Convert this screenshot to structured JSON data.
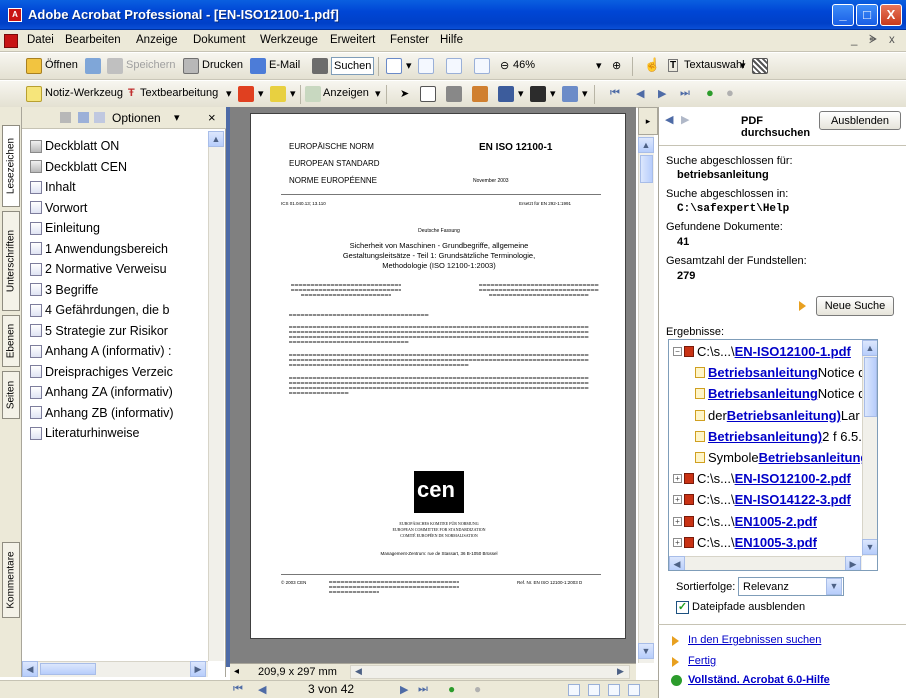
{
  "window": {
    "title": "Adobe Acrobat Professional - [EN-ISO12100-1.pdf]",
    "icon_label": "A",
    "buttons": {
      "minimize": "_",
      "maximize": "□",
      "close": "X"
    }
  },
  "menubar": {
    "items": [
      "Datei",
      "Bearbeiten",
      "Anzeige",
      "Dokument",
      "Werkzeuge",
      "Erweitert",
      "Fenster",
      "Hilfe"
    ],
    "doc_controls": [
      "_",
      "ᗙ",
      "x"
    ]
  },
  "toolbar1": {
    "open": "Öffnen",
    "save": "Speichern",
    "print": "Drucken",
    "email": "E-Mail",
    "search": "Suchen",
    "zoom": "46%",
    "text_select": "Textauswahl"
  },
  "toolbar2": {
    "note_tool": "Notiz-Werkzeug",
    "text_edit": "Textbearbeitung",
    "show": "Anzeigen"
  },
  "left_tabs": [
    "Lesezeichen",
    "Unterschriften",
    "Ebenen",
    "Seiten",
    "Kommentare"
  ],
  "bookmarks": {
    "options": "Optionen",
    "close": "×",
    "items": [
      {
        "label": "Deckblatt ON",
        "icon": "gray"
      },
      {
        "label": "Deckblatt CEN",
        "icon": "gray"
      },
      {
        "label": "Inhalt",
        "icon": "page"
      },
      {
        "label": "Vorwort",
        "icon": "page"
      },
      {
        "label": "Einleitung",
        "icon": "page"
      },
      {
        "label": "1  Anwendungsbereich",
        "icon": "page"
      },
      {
        "label": "2  Normative Verweisu",
        "icon": "page"
      },
      {
        "label": "3  Begriffe",
        "icon": "page"
      },
      {
        "label": "4  Gefährdungen, die b",
        "icon": "page"
      },
      {
        "label": "5  Strategie zur Risikor",
        "icon": "page"
      },
      {
        "label": "Anhang A (informativ) :",
        "icon": "page"
      },
      {
        "label": "Dreisprachiges Verzeic",
        "icon": "page"
      },
      {
        "label": "Anhang ZA (informativ)",
        "icon": "page"
      },
      {
        "label": "Anhang ZB (informativ)",
        "icon": "page"
      },
      {
        "label": "Literaturhinweise",
        "icon": "page"
      }
    ]
  },
  "page": {
    "norm_de": "EUROPÄISCHE NORM",
    "norm_en": "EUROPEAN STANDARD",
    "norm_fr": "NORME EUROPÉENNE",
    "number": "EN ISO 12100-1",
    "date": "November 2003",
    "ics": "ICS 01.040.13; 13.110",
    "replaces": "Ersetzt für EN 292-1:1991",
    "version": "Deutsche Fassung",
    "title_lines": [
      "Sicherheit von Maschinen - Grundbegriffe, allgemeine",
      "Gestaltungsleitsätze - Teil 1: Grundsätzliche Terminologie,",
      "Methodologie (ISO 12100-1:2003)"
    ],
    "cen": "cen",
    "committee": [
      "EUROPÄISCHES KOMITEE FÜR NORMUNG",
      "EUROPEAN COMMITTEE FOR STANDARDIZATION",
      "COMITÉ EUROPÉEN DE NORMALISATION"
    ],
    "address": "Management-Zentrum: rue de Stassart, 36   B-1050 Brüssel",
    "footer_left": "© 2003 CEN",
    "footer_right": "Ref. Nr. EN ISO 12100-1:2003 D"
  },
  "doc_status": {
    "page_size": "209,9 x 297 mm"
  },
  "nav": {
    "page": "3 von 42"
  },
  "search": {
    "header": "PDF durchsuchen",
    "hide_button": "Ausblenden",
    "done_for_label": "Suche abgeschlossen für:",
    "done_for_value": "betriebsanleitung",
    "done_in_label": "Suche abgeschlossen in:",
    "done_in_value": "C:\\safexpert\\Help",
    "found_docs_label": "Gefundene Dokumente:",
    "found_docs_value": "41",
    "total_label": "Gesamtzahl der Fundstellen:",
    "total_value": "279",
    "new_search": "Neue Suche",
    "results_label": "Ergebnisse:",
    "results": [
      {
        "prefix": "C:\\s...\\",
        "link": "EN-ISO12100-1.pdf",
        "rest": "",
        "level": 0,
        "expanded": true
      },
      {
        "prefix": "",
        "link": "Betriebsanleitung",
        "rest": " Notice d",
        "level": 1
      },
      {
        "prefix": "",
        "link": "Betriebsanleitung",
        "rest": " Notice d",
        "level": 1
      },
      {
        "prefix": "der ",
        "link": "Betriebsanleitung)",
        "rest": " Lar",
        "level": 1
      },
      {
        "prefix": "",
        "link": "Betriebsanleitung)",
        "rest": " 2 f 6.5.:",
        "level": 1
      },
      {
        "prefix": "Symbole ",
        "link": "Betriebsanleitung",
        "rest": "",
        "level": 1
      },
      {
        "prefix": "C:\\s...\\",
        "link": "EN-ISO12100-2.pdf",
        "rest": "",
        "level": 0
      },
      {
        "prefix": "C:\\s...\\",
        "link": "EN-ISO14122-3.pdf",
        "rest": "",
        "level": 0
      },
      {
        "prefix": "C:\\s...\\",
        "link": "EN1005-2.pdf",
        "rest": "",
        "level": 0
      },
      {
        "prefix": "C:\\s...\\",
        "link": "EN1005-3.pdf",
        "rest": "",
        "level": 0
      }
    ],
    "sort_label": "Sortierfolge:",
    "sort_value": "Relevanz",
    "hide_paths": "Dateipfade ausblenden",
    "links": [
      "In den Ergebnissen suchen",
      "Fertig",
      "Vollständ. Acrobat 6.0-Hilfe"
    ]
  },
  "colors": {
    "accent": "#0046d5",
    "link": "#0000c8",
    "arrow": "#e8a020"
  }
}
